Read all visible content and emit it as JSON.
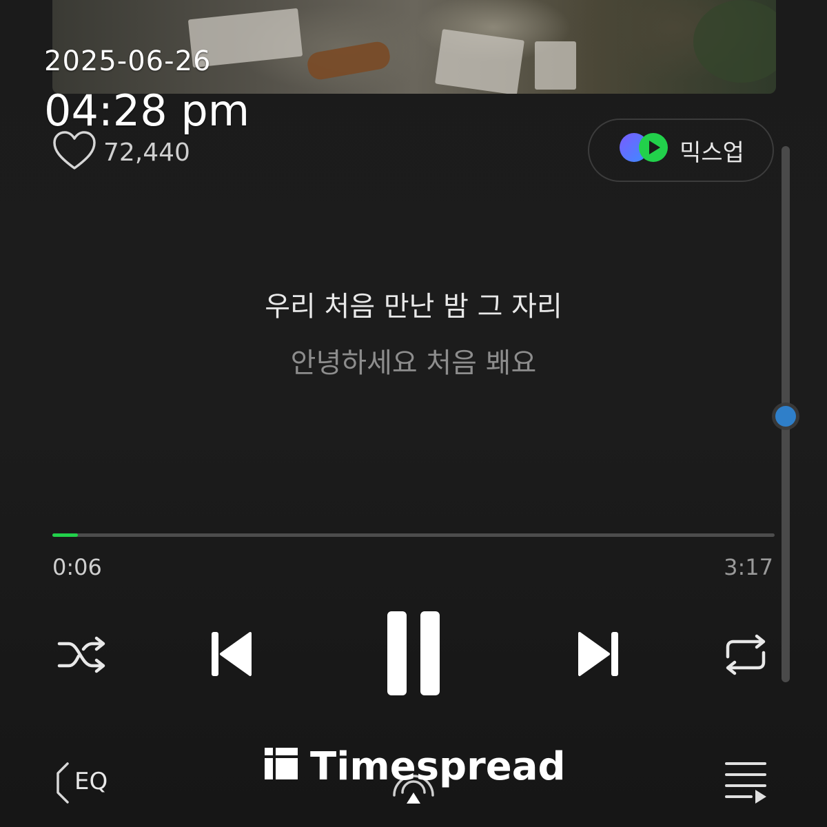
{
  "status": {
    "date": "2025-06-26",
    "time": "04:28 pm"
  },
  "track": {
    "like_count": "72,440"
  },
  "mixup": {
    "label": "믹스업"
  },
  "lyrics": {
    "current": "우리 처음 만난 밤 그 자리",
    "next": "안녕하세요 처음 봬요"
  },
  "playback": {
    "elapsed": "0:06",
    "duration": "3:17",
    "progress_fraction": 0.035,
    "lyrics_scroll_fraction": 0.5,
    "state": "playing"
  },
  "controls": {
    "shuffle": "shuffle-icon",
    "previous": "skip-previous-icon",
    "pause": "pause-icon",
    "next": "skip-next-icon",
    "repeat": "repeat-icon"
  },
  "bottom_bar": {
    "eq_label": "EQ",
    "cast": "cast-icon",
    "playlist": "playlist-icon"
  },
  "watermark": {
    "text": "Timespread"
  },
  "colors": {
    "accent": "#22d14b",
    "scroll_thumb": "#2f7fc9",
    "background": "#1b1b1b"
  }
}
